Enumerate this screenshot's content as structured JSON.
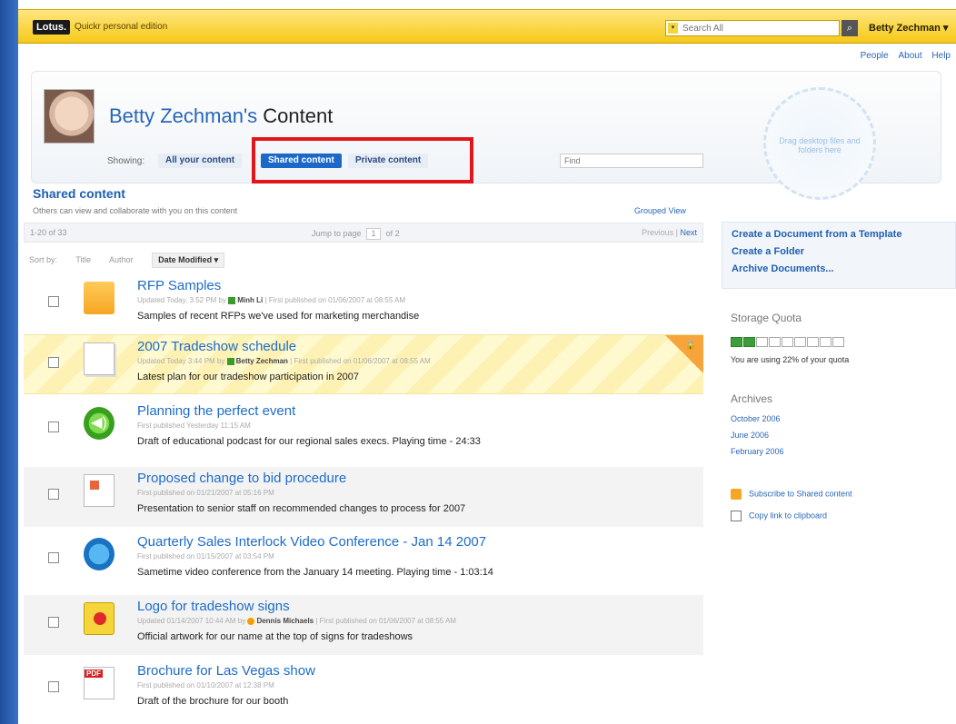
{
  "topbar": {
    "logo": "Lotus.",
    "edition": "Quickr personal edition",
    "search_placeholder": "Search All",
    "search_button": "⌕",
    "user": "Betty Zechman ▾"
  },
  "toplinks": [
    "People",
    "About",
    "Help"
  ],
  "header": {
    "owner": "Betty Zechman's",
    "title_suffix": " Content",
    "showing_label": "Showing:",
    "filters": [
      "All your content",
      "Shared content",
      "Private content"
    ],
    "find_placeholder": "Find"
  },
  "dropzone": {
    "text": "Drag desktop files and folders here"
  },
  "section": {
    "title": "Shared content",
    "description": "Others can view and collaborate with you on this content",
    "grouped_view": "Grouped View"
  },
  "pager": {
    "count": "1-20 of 33",
    "jump_label": "Jump to page",
    "page": "1",
    "of": "of 2",
    "previous": "Previous",
    "next": "Next"
  },
  "sort": {
    "label": "Sort by:",
    "options": [
      "Title",
      "Author"
    ],
    "active": "Date Modified ▾"
  },
  "rows": [
    {
      "title": "RFP Samples",
      "meta_prefix": "Updated Today, 3:52 PM by ",
      "author": "Minh Li",
      "meta_suffix": " | First published on 01/06/2007 at 08:55 AM",
      "desc": "Samples of recent RFPs we've used for marketing merchandise",
      "icon": "folder-icon"
    },
    {
      "title": "2007 Tradeshow schedule",
      "meta_prefix": "Updated Today 3:44 PM by ",
      "author": "Betty Zechman",
      "meta_suffix": " | First published on 01/06/2007 at 08:55 AM",
      "desc": "Latest plan for our tradeshow participation in 2007",
      "icon": "document-icon"
    },
    {
      "title": "Planning the perfect event",
      "meta_prefix": "First published Yesterday 11:15 AM",
      "author": "",
      "meta_suffix": "",
      "desc": "Draft of educational podcast for our regional sales execs. Playing time - 24:33",
      "icon": "sound-icon"
    },
    {
      "title": "Proposed change to bid procedure",
      "meta_prefix": "First published on 01/21/2007 at 05:16 PM",
      "author": "",
      "meta_suffix": "",
      "desc": "Presentation to senior staff on recommended changes to process for 2007",
      "icon": "presentation-icon"
    },
    {
      "title": "Quarterly Sales Interlock Video Conference - Jan 14 2007",
      "meta_prefix": "First published on 01/15/2007 at 03:54 PM",
      "author": "",
      "meta_suffix": "",
      "desc": "Sametime video conference from the January 14 meeting. Playing time - 1:03:14",
      "icon": "video-icon"
    },
    {
      "title": "Logo for tradeshow signs",
      "meta_prefix": "Updated 01/14/2007 10:44 AM by ",
      "author": "Dennis Michaels",
      "meta_suffix": " | First published on 01/06/2007 at 08:55 AM",
      "desc": "Official artwork for our name at the top of signs for tradeshows",
      "icon": "image-icon"
    },
    {
      "title": "Brochure for Las Vegas show",
      "meta_prefix": "First published on 01/10/2007 at 12:38 PM",
      "author": "",
      "meta_suffix": "",
      "desc": "Draft of the brochure for our booth",
      "icon": "pdf-icon"
    }
  ],
  "sidebar": {
    "actions": [
      "Create a Document from a Template",
      "Create a Folder",
      "Archive Documents..."
    ],
    "storage_title": "Storage Quota",
    "quota_used_fraction": 0.22,
    "quota_text": "You are using 22% of your quota",
    "archives_title": "Archives",
    "archives": [
      "October 2006",
      "June 2006",
      "February 2006"
    ],
    "subscribe": "Subscribe to Shared content",
    "copy_link": "Copy link to clipboard"
  },
  "colors": {
    "accent": "#1e6cc8",
    "topbar": "#f5c918",
    "highlight": "#e0161b",
    "background": "#2a5fb0"
  }
}
